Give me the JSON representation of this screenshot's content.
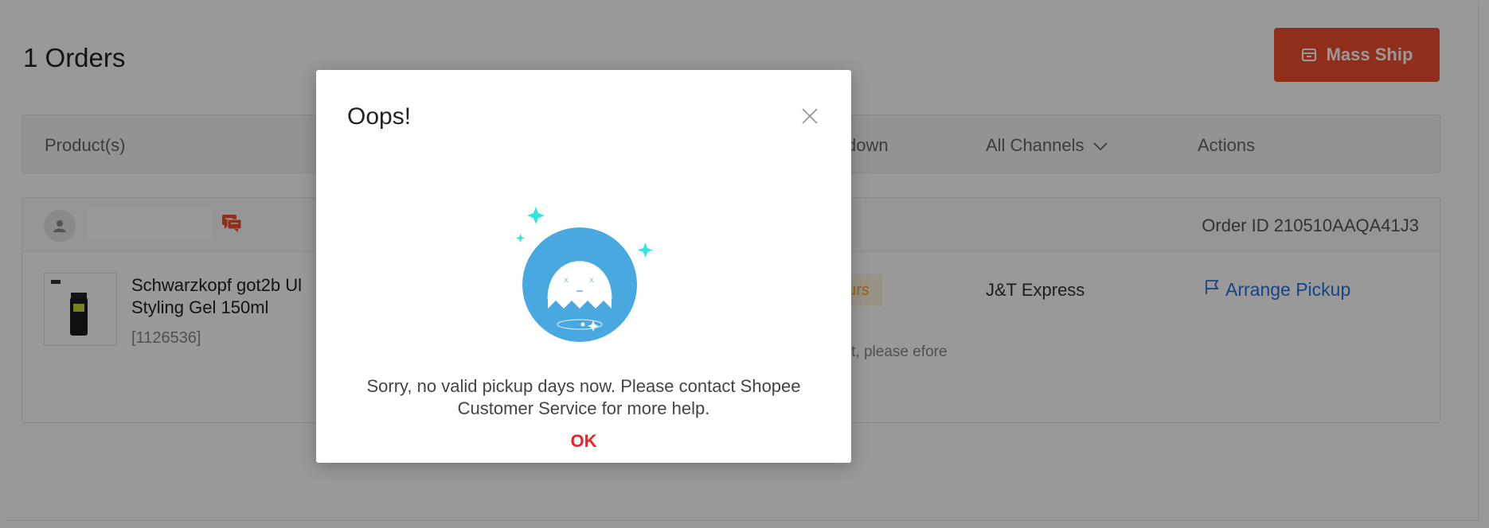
{
  "orders": {
    "title": "1 Orders",
    "mass_ship_label": "Mass Ship"
  },
  "table_header": {
    "product_label": "Product(s)",
    "countdown_partial": "down",
    "channels_label": "All Channels",
    "actions_label": "Actions"
  },
  "order": {
    "order_id_text": "Order ID 210510AAQA41J3",
    "product_name": "Schwarzkopf got2b Ul Styling Gel 150ml",
    "product_sku": "[1126536]",
    "countdown_tag_partial": "urs",
    "countdown_note_partial": "ent, please efore",
    "carrier": "J&T Express",
    "arrange_pickup_label": "Arrange Pickup"
  },
  "modal": {
    "title": "Oops!",
    "message": "Sorry, no valid pickup days now. Please contact Shopee Customer Service for more help.",
    "ok_label": "OK"
  },
  "colors": {
    "brand": "#ee4d2d",
    "link": "#2673dd",
    "ok": "#ee2222",
    "ghost_bg": "#4aa8e0",
    "sparkle": "#2ee6e0"
  },
  "icons": {
    "mass_ship": "box-icon",
    "close": "close-icon",
    "channel_chevron": "chevron-down-icon",
    "chat": "chat-icon",
    "pickup": "flag-icon",
    "illustration": "ghost-icon"
  }
}
